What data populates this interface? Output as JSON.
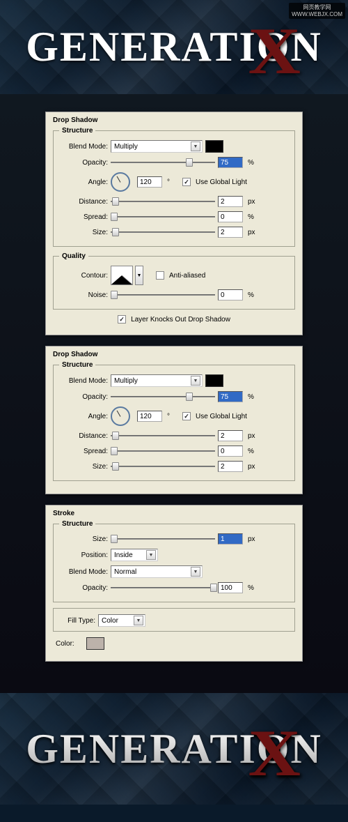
{
  "watermark": {
    "line1": "网页教学网",
    "line2": "WWW.WEBJX.COM"
  },
  "header": {
    "text": "GENERATION",
    "x": "X"
  },
  "footer": {
    "text": "GENERATION",
    "x": "X"
  },
  "panel1": {
    "title": "Drop Shadow",
    "structure": {
      "legend": "Structure",
      "blend_mode_label": "Blend Mode:",
      "blend_mode_value": "Multiply",
      "opacity_label": "Opacity:",
      "opacity_value": "75",
      "opacity_unit": "%",
      "angle_label": "Angle:",
      "angle_value": "120",
      "angle_unit": "°",
      "global_light_label": "Use Global Light",
      "distance_label": "Distance:",
      "distance_value": "2",
      "distance_unit": "px",
      "spread_label": "Spread:",
      "spread_value": "0",
      "spread_unit": "%",
      "size_label": "Size:",
      "size_value": "2",
      "size_unit": "px"
    },
    "quality": {
      "legend": "Quality",
      "contour_label": "Contour:",
      "anti_aliased_label": "Anti-aliased",
      "noise_label": "Noise:",
      "noise_value": "0",
      "noise_unit": "%"
    },
    "knockout_label": "Layer Knocks Out Drop Shadow"
  },
  "panel2": {
    "title": "Drop Shadow",
    "structure": {
      "legend": "Structure",
      "blend_mode_label": "Blend Mode:",
      "blend_mode_value": "Multiply",
      "opacity_label": "Opacity:",
      "opacity_value": "75",
      "opacity_unit": "%",
      "angle_label": "Angle:",
      "angle_value": "120",
      "angle_unit": "°",
      "global_light_label": "Use Global Light",
      "distance_label": "Distance:",
      "distance_value": "2",
      "distance_unit": "px",
      "spread_label": "Spread:",
      "spread_value": "0",
      "spread_unit": "%",
      "size_label": "Size:",
      "size_value": "2",
      "size_unit": "px"
    }
  },
  "panel3": {
    "title": "Stroke",
    "structure": {
      "legend": "Structure",
      "size_label": "Size:",
      "size_value": "1",
      "size_unit": "px",
      "position_label": "Position:",
      "position_value": "Inside",
      "blend_mode_label": "Blend Mode:",
      "blend_mode_value": "Normal",
      "opacity_label": "Opacity:",
      "opacity_value": "100",
      "opacity_unit": "%"
    },
    "fill": {
      "fill_type_label": "Fill Type:",
      "fill_type_value": "Color",
      "color_label": "Color:"
    }
  }
}
